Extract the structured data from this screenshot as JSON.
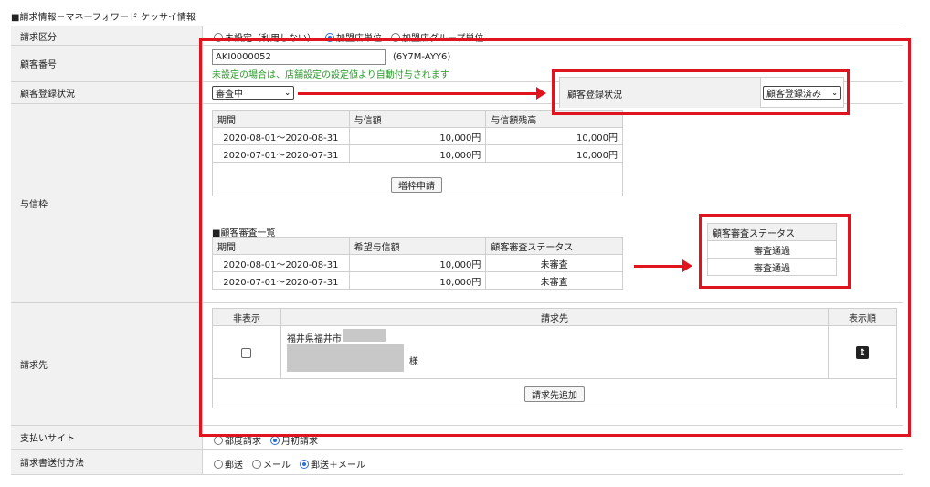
{
  "section_title": "■請求情報－マネーフォワード ケッサイ情報",
  "rows": {
    "billing_category": {
      "label": "請求区分",
      "options": [
        "未設定（利用しない）",
        "加盟店単位",
        "加盟店グループ単位"
      ],
      "selected": 1
    },
    "customer_number": {
      "label": "顧客番号",
      "value": "AKI0000052",
      "code": "(6Y7M-AYY6)",
      "note": "未設定の場合は、店舗設定の設定値より自動付与されます"
    },
    "customer_registration": {
      "label": "顧客登録状況",
      "select_value": "審査中",
      "callout_label": "顧客登録状況",
      "callout_value": "顧客登録済み"
    },
    "credit_limit": {
      "label": "与信枠",
      "headers": [
        "期間",
        "与信額",
        "与信額残高"
      ],
      "rows": [
        [
          "2020-08-01～2020-08-31",
          "10,000円",
          "10,000円"
        ],
        [
          "2020-07-01～2020-07-31",
          "10,000円",
          "10,000円"
        ]
      ],
      "increase_button": "増枠申請",
      "review_title": "■顧客審査一覧",
      "review_headers": [
        "期間",
        "希望与信額",
        "顧客審査ステータス"
      ],
      "review_rows": [
        [
          "2020-08-01～2020-08-31",
          "10,000円",
          "未審査"
        ],
        [
          "2020-07-01～2020-07-31",
          "10,000円",
          "未審査"
        ]
      ],
      "callout_header": "顧客審査ステータス",
      "callout_values": [
        "審査通過",
        "審査通過"
      ]
    },
    "billing_destination": {
      "label": "請求先",
      "headers": [
        "非表示",
        "請求先",
        "表示順"
      ],
      "address_prefix": "福井県福井市",
      "honorific": "様",
      "add_button": "請求先追加"
    },
    "payment_site": {
      "label": "支払いサイト",
      "options": [
        "都度請求",
        "月初請求"
      ],
      "selected": 1
    },
    "invoice_delivery": {
      "label": "請求書送付方法",
      "options": [
        "郵送",
        "メール",
        "郵送＋メール"
      ],
      "selected": 2
    }
  },
  "colors": {
    "highlight": "#e0141e",
    "note": "#2a9a2a",
    "radio": "#2a6de0"
  }
}
